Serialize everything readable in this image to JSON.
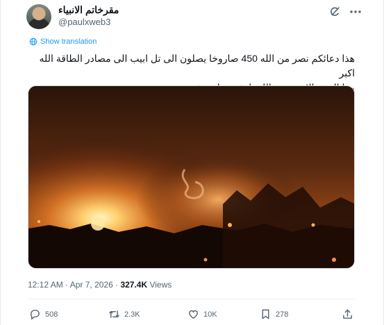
{
  "author": {
    "name": "مقرخاتم الانبياء",
    "handle": "@paulxweb3"
  },
  "icons": {
    "grok": "grok-icon",
    "more": "more-icon",
    "translate": "globe-icon",
    "reply": "reply-icon",
    "repost": "repost-icon",
    "like": "heart-icon",
    "bookmark": "bookmark-icon",
    "share": "share-icon"
  },
  "translate_label": "Show translation",
  "tweet": {
    "line1": "هذا دعائكم نصر من الله 450 صاروخا يصلون الى تل ابيب الى مصادر الطاقة الله اكبر",
    "line2": "وما النصر الا من عند الله، انشرو واستبشرو"
  },
  "meta": {
    "time": "12:12 AM",
    "sep1": " · ",
    "date": "Apr 7, 2026",
    "sep2": " · ",
    "views_count": "327.4K",
    "views_label": " Views"
  },
  "actions": {
    "replies": "508",
    "reposts": "2.3K",
    "likes": "10K",
    "bookmarks": "278"
  },
  "colors": {
    "accent": "#1d9bf0",
    "text": "#0f1419",
    "muted": "#536471"
  }
}
